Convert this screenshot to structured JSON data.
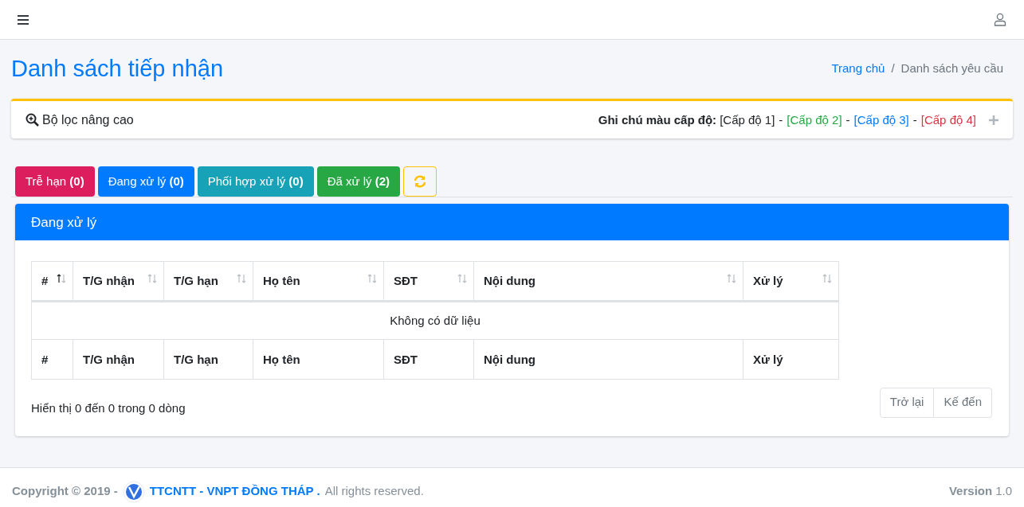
{
  "page_title": "Danh sách tiếp nhận",
  "breadcrumb": [
    {
      "label": "Trang chủ",
      "link": true
    },
    {
      "label": "Danh sách yêu cầu",
      "link": false
    }
  ],
  "breadcrumb_separator": "/",
  "filter": {
    "label": "Bộ lọc nâng cao",
    "legend_label": "Ghi chú màu cấp độ:",
    "levels": [
      {
        "label": "[Cấp độ 1]",
        "color": "#212529"
      },
      {
        "label": "[Cấp độ 2]",
        "color": "#28a745"
      },
      {
        "label": "[Cấp độ 3]",
        "color": "#007bff"
      },
      {
        "label": "[Cấp độ 4]",
        "color": "#dc3545"
      }
    ],
    "separator": "-"
  },
  "tabs": [
    {
      "label": "Trễ hạn",
      "count": "(0)",
      "color": "#dc1e5e"
    },
    {
      "label": "Đang xử lý",
      "count": "(0)",
      "color": "#007bff"
    },
    {
      "label": "Phối hợp xử lý",
      "count": "(0)",
      "color": "#17a2b8"
    },
    {
      "label": "Đã xử lý",
      "count": "(2)",
      "color": "#28a745"
    }
  ],
  "panel": {
    "title": "Đang xử lý"
  },
  "table": {
    "columns": [
      {
        "label": "#",
        "sorted": true
      },
      {
        "label": "T/G nhận",
        "sorted": false
      },
      {
        "label": "T/G hạn",
        "sorted": false
      },
      {
        "label": "Họ tên",
        "sorted": false
      },
      {
        "label": "SĐT",
        "sorted": false
      },
      {
        "label": "Nội dung",
        "sorted": false
      },
      {
        "label": "Xử lý",
        "sorted": false
      }
    ],
    "empty_message": "Không có dữ liệu",
    "footer_columns": [
      "#",
      "T/G nhận",
      "T/G hạn",
      "Họ tên",
      "SĐT",
      "Nội dung",
      "Xử lý"
    ]
  },
  "info": "Hiển thị 0 đến 0 trong 0 dòng",
  "pagination": [
    "Trở lại",
    "Kế đến"
  ],
  "footer": {
    "copyright": "Copyright © 2019 -",
    "org": "TTCNTT - VNPT ĐỒNG THÁP .",
    "rights": "All rights reserved.",
    "version_label": "Version",
    "version": "1.0"
  }
}
